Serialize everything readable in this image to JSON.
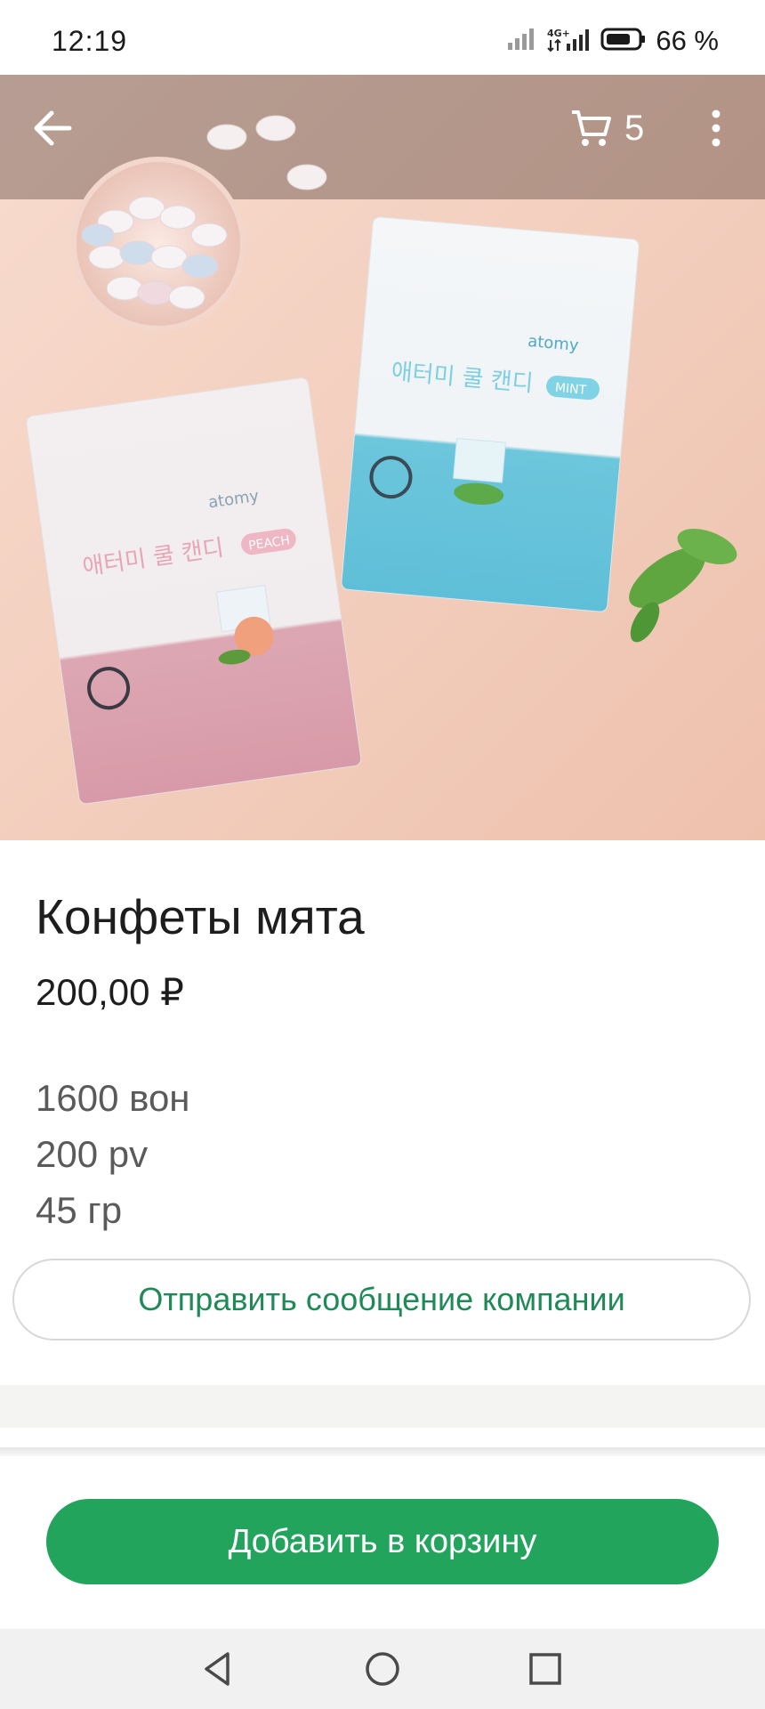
{
  "status_bar": {
    "time": "12:19",
    "network": "4G+",
    "battery": "66 %",
    "icons": [
      "signal-icon",
      "mobile-data-icon",
      "battery-icon"
    ]
  },
  "header": {
    "back_icon": "arrow-left-icon",
    "cart_icon": "shopping-cart-icon",
    "cart_count": "5",
    "menu_icon": "more-vertical-icon"
  },
  "hero_image": {
    "description_icon": "product-photo",
    "brand_text": "atomy",
    "pouch_labels": [
      "PEACH",
      "MINT"
    ]
  },
  "product": {
    "title": "Конфеты мята",
    "price": "200,00 ₽",
    "details": [
      "1600 вон",
      "200 pv",
      "45 гр"
    ]
  },
  "actions": {
    "message_label": "Отправить сообщение компании",
    "add_to_cart_label": "Добавить в корзину"
  },
  "colors": {
    "accent_green": "#22a45d",
    "message_text_green": "#1f8a57",
    "background": "#ffffff"
  },
  "nav_bar": {
    "icons": [
      "nav-back-icon",
      "nav-home-icon",
      "nav-recents-icon"
    ]
  }
}
